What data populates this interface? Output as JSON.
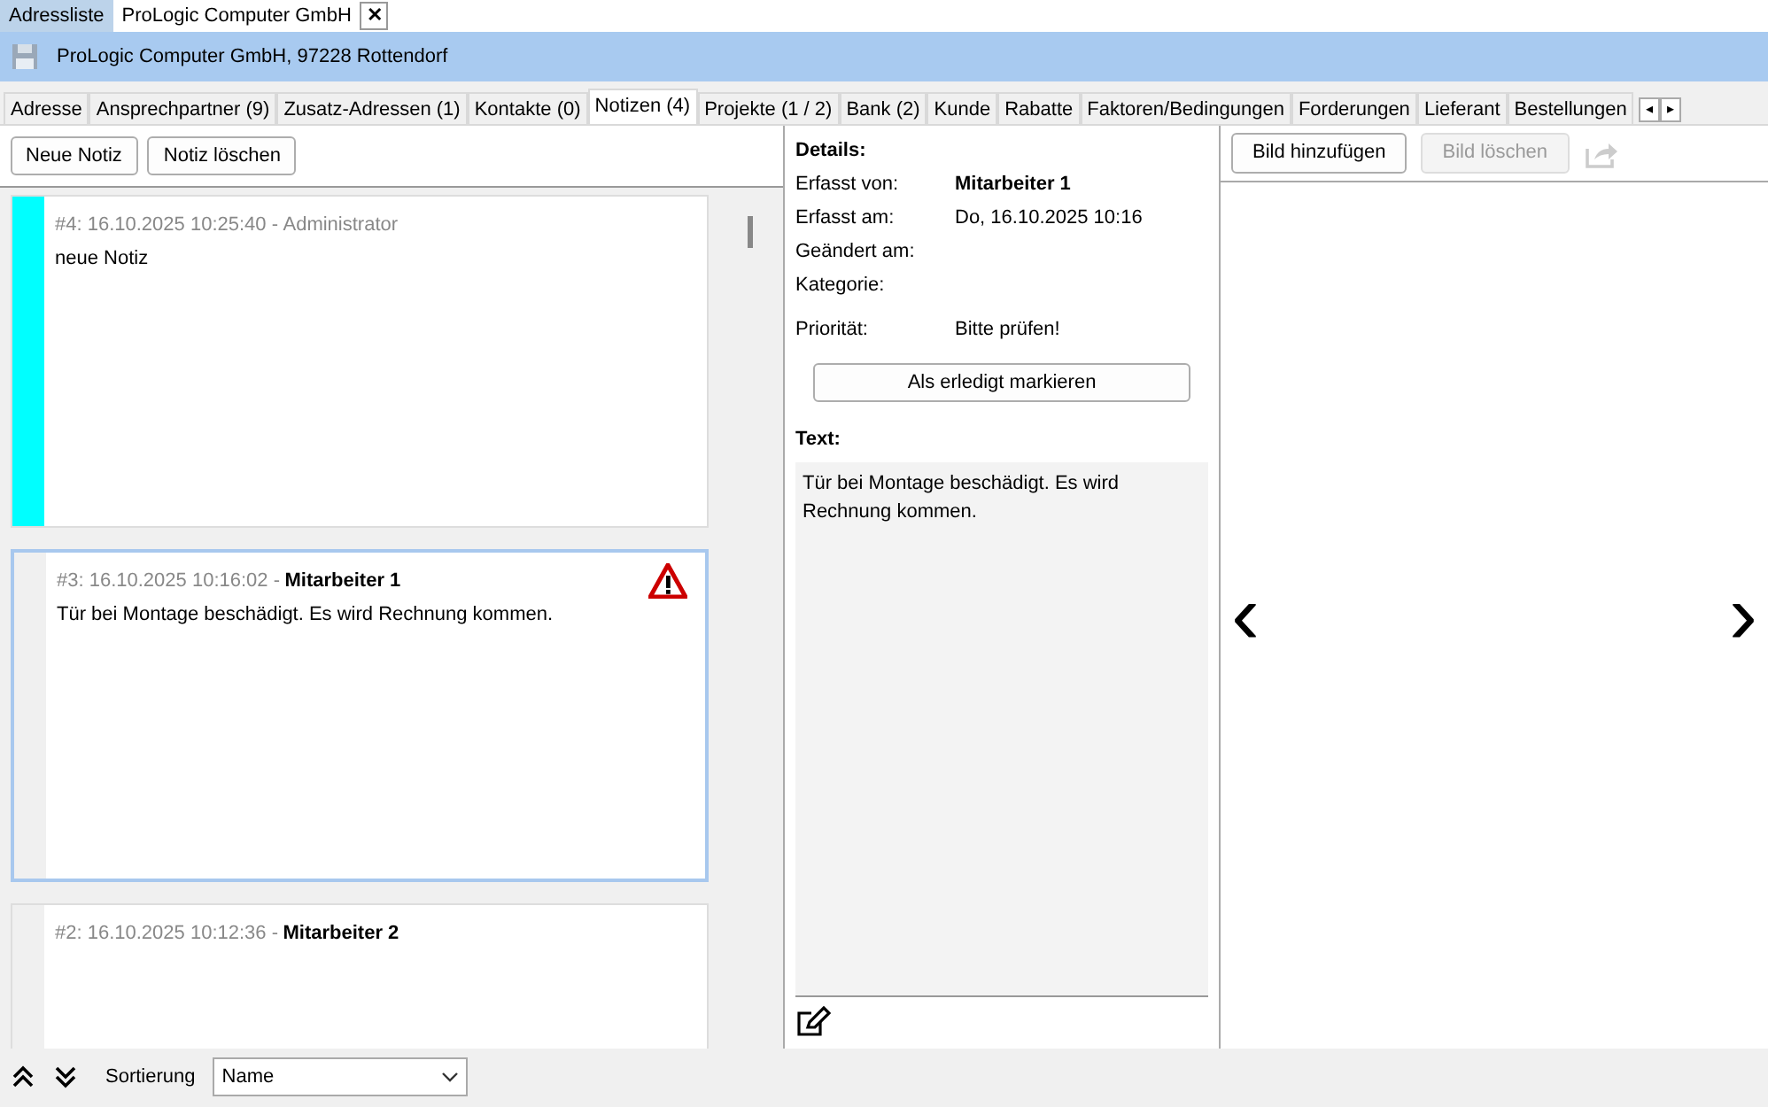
{
  "doc_tabs": [
    {
      "label": "Adressliste",
      "selected": false
    },
    {
      "label": "ProLogic Computer GmbH",
      "selected": true
    }
  ],
  "doc_close": "✕",
  "header": {
    "title": "ProLogic Computer GmbH, 97228 Rottendorf"
  },
  "tabs": [
    {
      "label": "Adresse",
      "selected": false
    },
    {
      "label": "Ansprechpartner (9)",
      "selected": false
    },
    {
      "label": "Zusatz-Adressen (1)",
      "selected": false
    },
    {
      "label": "Kontakte (0)",
      "selected": false
    },
    {
      "label": "Notizen (4)",
      "selected": true
    },
    {
      "label": "Projekte (1 / 2)",
      "selected": false
    },
    {
      "label": "Bank (2)",
      "selected": false
    },
    {
      "label": "Kunde",
      "selected": false
    },
    {
      "label": "Rabatte",
      "selected": false
    },
    {
      "label": "Faktoren/Bedingungen",
      "selected": false
    },
    {
      "label": "Forderungen",
      "selected": false
    },
    {
      "label": "Lieferant",
      "selected": false
    },
    {
      "label": "Bestellungen",
      "selected": false
    }
  ],
  "tab_scroll": [
    "◂",
    "▸"
  ],
  "note_buttons": [
    {
      "label": "Neue Notiz",
      "disabled": false
    },
    {
      "label": "Notiz löschen",
      "disabled": false
    }
  ],
  "notes": [
    {
      "meta": "#4: 16.10.2025 10:25:40 -",
      "author": "Administrator",
      "author_bold": false,
      "text": "neue Notiz",
      "color": "#00ffff",
      "selected": false,
      "warning": false
    },
    {
      "meta": "#3: 16.10.2025 10:16:02 -",
      "author": "Mitarbeiter 1",
      "author_bold": true,
      "text": "Tür bei Montage beschädigt. Es wird Rechnung kommen.",
      "color": "#f0f0f0",
      "selected": true,
      "warning": true
    },
    {
      "meta": "#2: 16.10.2025 10:12:36 -",
      "author": "Mitarbeiter 2",
      "author_bold": true,
      "color": "#f0f0f0",
      "selected": false,
      "warning": false
    }
  ],
  "details": {
    "heading": "Details:",
    "fields": [
      {
        "label": "Erfasst von:",
        "value": "Mitarbeiter 1",
        "bold": true
      },
      {
        "label": "Erfasst am:",
        "value": "Do, 16.10.2025 10:16"
      },
      {
        "label": "Geändert am:"
      },
      {
        "label": "Kategorie:"
      },
      {
        "label": "Priorität:",
        "value": "Bitte prüfen!"
      }
    ],
    "mark_button": "Als erledigt markieren",
    "text_heading": "Text:",
    "text": "Tür bei Montage beschädigt. Es wird Rechnung kommen."
  },
  "image_buttons": [
    {
      "label": "Bild hinzufügen",
      "disabled": false
    },
    {
      "label": "Bild löschen",
      "disabled": true
    }
  ],
  "gallery_nav": [
    "‹",
    "›"
  ],
  "footer": {
    "sort_label": "Sortierung",
    "sort_value": "Name"
  }
}
